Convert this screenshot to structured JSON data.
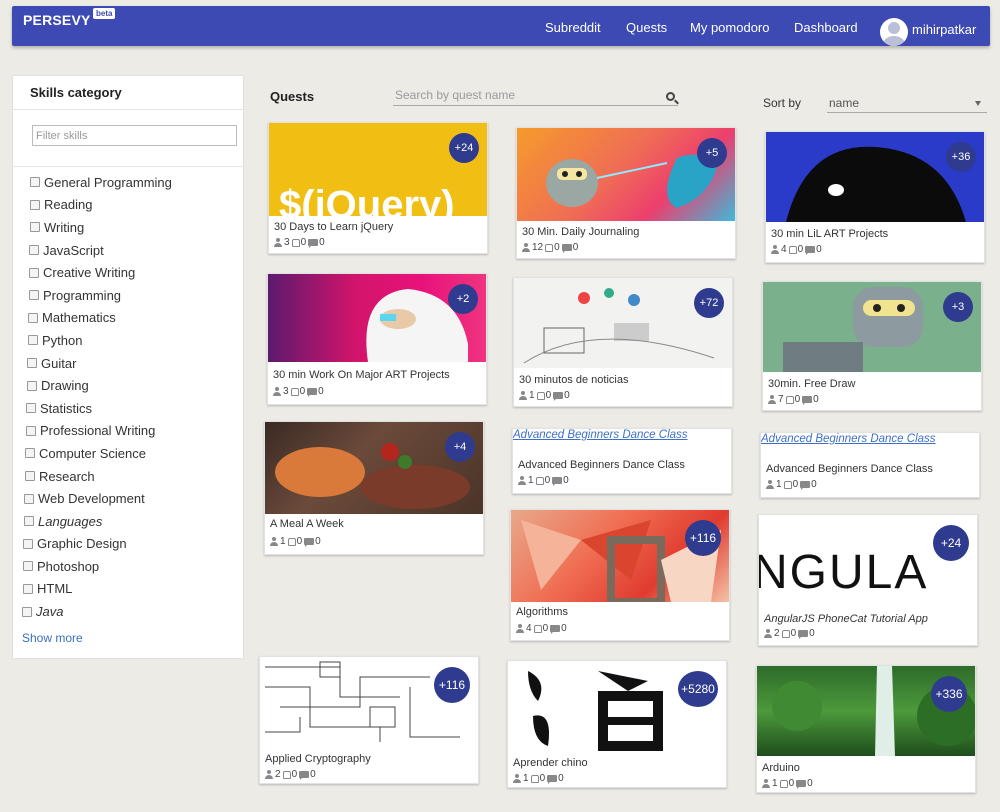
{
  "header": {
    "logo": "PERSEVY",
    "badge": "beta",
    "nav": [
      "Subreddit",
      "Quests",
      "My pomodoro",
      "Dashboard"
    ],
    "username": "mihirpatkar"
  },
  "sidebar": {
    "title": "Skills category",
    "filter_placeholder": "Filter skills",
    "skills": [
      "General Programming",
      "Reading",
      "Writing",
      "JavaScript",
      "Creative Writing",
      "Programming",
      "Mathematics",
      "Python",
      "Guitar",
      "Drawing",
      "Statistics",
      "Professional Writing",
      "Computer Science",
      "Research",
      "Web Development",
      "Languages",
      "Graphic Design",
      "Photoshop",
      "HTML",
      "Java"
    ],
    "show_more": "Show more"
  },
  "quests": {
    "title": "Quests",
    "search_placeholder": "Search by quest name",
    "sort_label": "Sort by",
    "sort_value": "name"
  },
  "cards": [
    {
      "title": "30 Days to Learn jQuery",
      "badge": "+24",
      "users": "3",
      "likes": "0",
      "comments": "0",
      "thumb_text": "$(jQuery)"
    },
    {
      "title": "30 Min. Daily Journaling",
      "badge": "+5",
      "users": "12",
      "likes": "0",
      "comments": "0"
    },
    {
      "title": "30 min LiL ART Projects",
      "badge": "+36",
      "users": "4",
      "likes": "0",
      "comments": "0"
    },
    {
      "title": "30 min Work On Major ART Projects",
      "badge": "+2",
      "users": "3",
      "likes": "0",
      "comments": "0"
    },
    {
      "title": "30 minutos de noticias",
      "badge": "+72",
      "users": "1",
      "likes": "0",
      "comments": "0"
    },
    {
      "title": "30min. Free Draw",
      "badge": "+3",
      "users": "7",
      "likes": "0",
      "comments": "0"
    },
    {
      "title": "A Meal A Week",
      "badge": "+4",
      "users": "1",
      "likes": "0",
      "comments": "0"
    },
    {
      "title": "Advanced Beginners Dance Class",
      "badge": "",
      "users": "1",
      "likes": "0",
      "comments": "0",
      "thumb_text": "Advanced Beginners Dance Class"
    },
    {
      "title": "Advanced Beginners Dance Class",
      "badge": "",
      "users": "1",
      "likes": "0",
      "comments": "0",
      "thumb_text": "Advanced Beginners Dance Class"
    },
    {
      "title": "Algorithms",
      "badge": "+116",
      "users": "4",
      "likes": "0",
      "comments": "0"
    },
    {
      "title": "AngularJS PhoneCat Tutorial App",
      "badge": "+24",
      "users": "2",
      "likes": "0",
      "comments": "0",
      "thumb_text": "NGULA"
    },
    {
      "title": "Applied Cryptography",
      "badge": "+116",
      "users": "2",
      "likes": "0",
      "comments": "0"
    },
    {
      "title": "Aprender chino",
      "badge": "+5280",
      "users": "1",
      "likes": "0",
      "comments": "0"
    },
    {
      "title": "Arduino",
      "badge": "+336",
      "users": "1",
      "likes": "0",
      "comments": "0"
    }
  ]
}
